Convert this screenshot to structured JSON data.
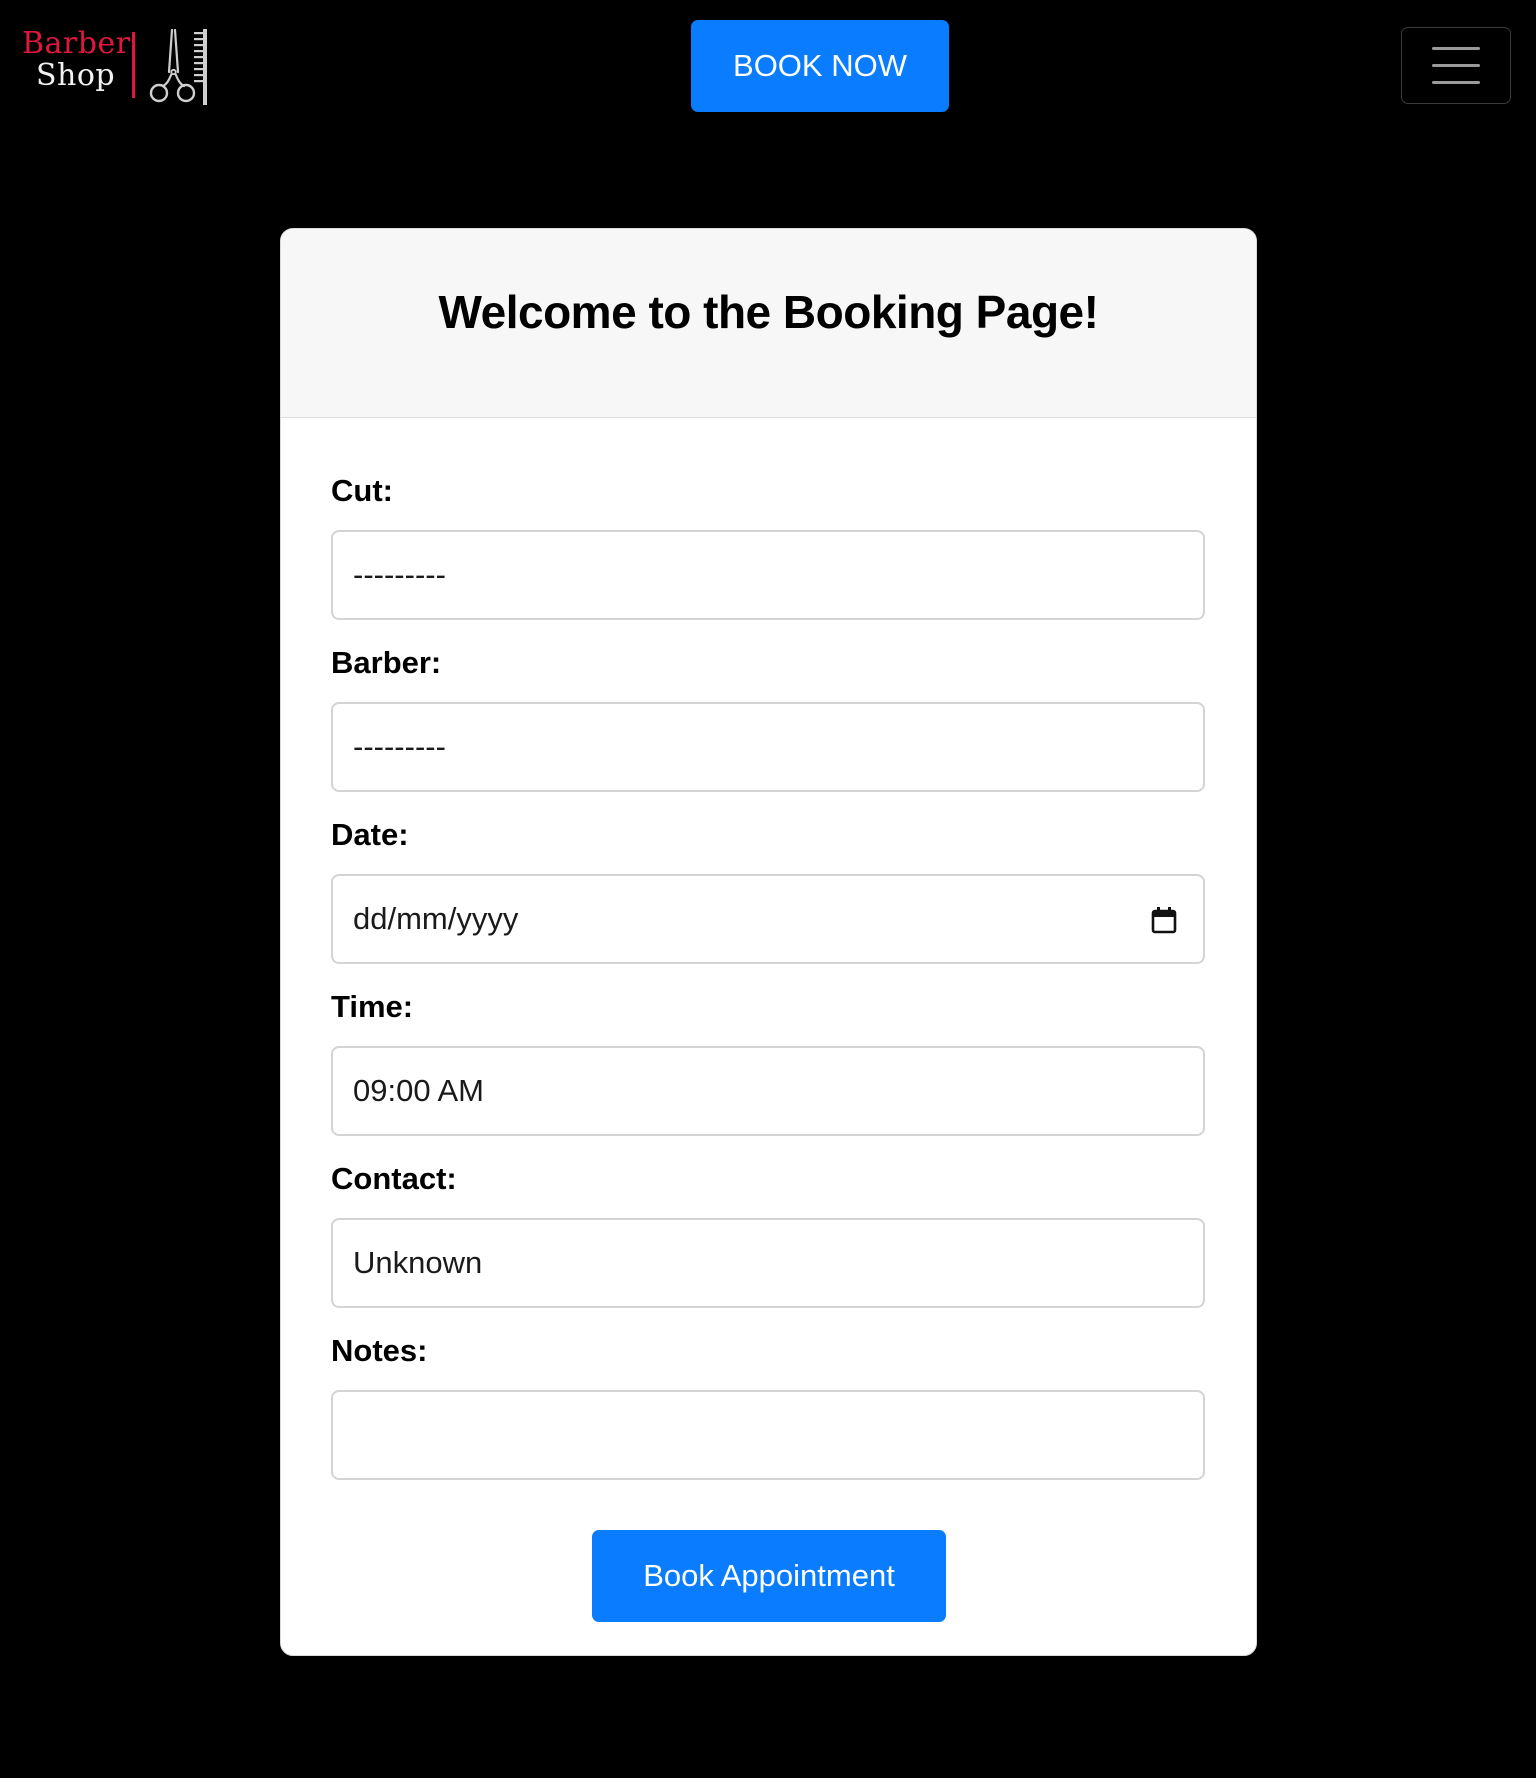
{
  "navbar": {
    "brand_line1": "Barber",
    "brand_line2": "Shop",
    "brand_icon": "scissors-comb-icon",
    "book_now_label": "BOOK NOW",
    "menu_icon": "hamburger-menu-icon"
  },
  "card": {
    "title": "Welcome to the Booking Page!"
  },
  "form": {
    "cut": {
      "label": "Cut:",
      "value": "---------"
    },
    "barber": {
      "label": "Barber:",
      "value": "---------"
    },
    "date": {
      "label": "Date:",
      "placeholder": "dd/mm/yyyy",
      "icon": "calendar-icon"
    },
    "time": {
      "label": "Time:",
      "value": "09:00 AM"
    },
    "contact": {
      "label": "Contact:",
      "value": "Unknown"
    },
    "notes": {
      "label": "Notes:",
      "value": ""
    },
    "submit_label": "Book Appointment"
  },
  "colors": {
    "page_background": "#000000",
    "primary_button": "#0a7cff",
    "brand_accent": "#e0173d",
    "card_header_background": "#f7f7f7"
  }
}
